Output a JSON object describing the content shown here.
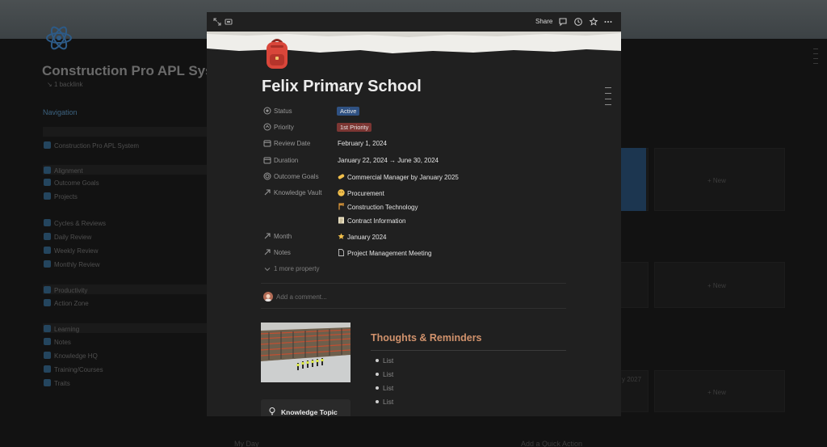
{
  "background": {
    "title": "Construction Pro APL Sys",
    "backlink": "1 backlink",
    "nav_heading": "Navigation",
    "items": {
      "system": "Construction Pro APL System",
      "alignment": "Alignment",
      "outcome_goals": "Outcome Goals",
      "projects": "Projects",
      "cycles": "Cycles & Reviews",
      "daily": "Daily Review",
      "weekly": "Weekly Review",
      "monthly": "Monthly Review",
      "productivity": "Productivity",
      "action_zone": "Action Zone",
      "learning": "Learning",
      "notes": "Notes",
      "knowledge_hq": "Knowledge HQ",
      "training": "Training/Courses",
      "traits": "Traits"
    },
    "new_label": "+ New",
    "partial_date": "y 2027",
    "my_day": "My Day",
    "quick_action": "Add a Quick Action"
  },
  "modal": {
    "share_label": "Share",
    "title": "Felix Primary School",
    "properties": {
      "status": {
        "label": "Status",
        "value": "Active",
        "color": "#2f5182"
      },
      "priority": {
        "label": "Priority",
        "value": "1st Priority",
        "color": "#7c3633"
      },
      "review_date": {
        "label": "Review Date",
        "value": "February 1, 2024"
      },
      "duration": {
        "label": "Duration",
        "value": "January 22, 2024 → June 30, 2024"
      },
      "outcome_goals": {
        "label": "Outcome Goals",
        "value": "Commercial Manager by January 2025"
      },
      "knowledge_vault": {
        "label": "Knowledge Vault",
        "values": [
          "Procurement",
          "Construction Technology",
          "Contract Information"
        ]
      },
      "month": {
        "label": "Month",
        "value": "January 2024"
      },
      "notes": {
        "label": "Notes",
        "value": "Project Management Meeting"
      }
    },
    "more_property": "1 more property",
    "comment_placeholder": "Add a comment...",
    "knowledge_topic": "Knowledge Topic",
    "thoughts_heading": "Thoughts & Reminders",
    "bullets": [
      "List",
      "List",
      "List",
      "List"
    ]
  },
  "icons": {
    "expand": "expand-icon",
    "page": "page-icon",
    "comments": "comment-icon",
    "updates": "clock-icon",
    "favorite": "star-icon",
    "more": "more-icon",
    "backpack": "backpack-icon",
    "bulb": "bulb-icon"
  },
  "colors": {
    "accent_heading": "#d1926c",
    "modal_bg": "#202020",
    "status_active": "#2f5182",
    "priority_1st": "#7c3633"
  }
}
